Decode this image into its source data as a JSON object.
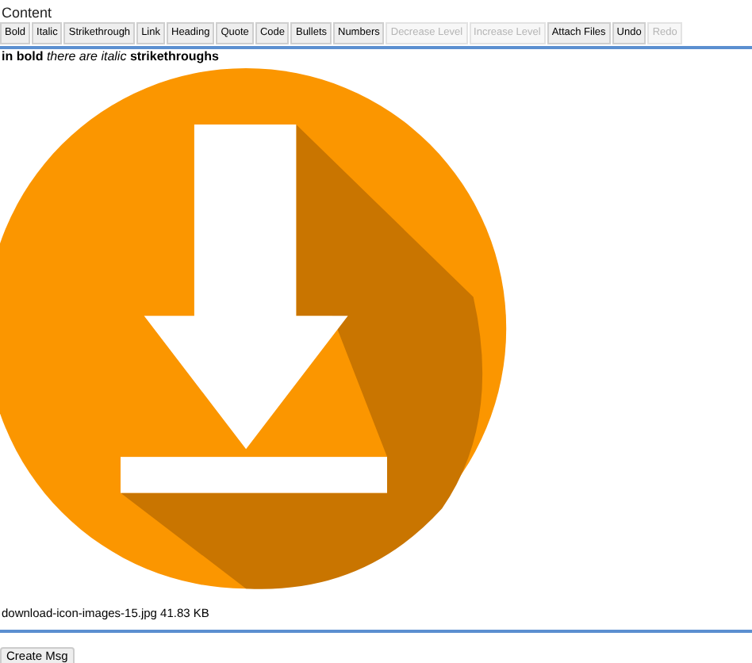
{
  "field_label": "Content",
  "toolbar": [
    {
      "label": "Bold",
      "disabled": false
    },
    {
      "label": "Italic",
      "disabled": false
    },
    {
      "label": "Strikethrough",
      "disabled": false
    },
    {
      "label": "Link",
      "disabled": false
    },
    {
      "label": "Heading",
      "disabled": false
    },
    {
      "label": "Quote",
      "disabled": false
    },
    {
      "label": "Code",
      "disabled": false
    },
    {
      "label": "Bullets",
      "disabled": false
    },
    {
      "label": "Numbers",
      "disabled": false
    },
    {
      "label": "Decrease Level",
      "disabled": true
    },
    {
      "label": "Increase Level",
      "disabled": true
    },
    {
      "label": "Attach Files",
      "disabled": false
    },
    {
      "label": "Undo",
      "disabled": false
    },
    {
      "label": "Redo",
      "disabled": true
    }
  ],
  "content_text": "**in bold** *there are italic* **strikethroughs**",
  "attachment": {
    "kind": "picture",
    "caption": "download-icon-images-15.jpg 41.83 KB"
  },
  "submit_button": "Create Msg"
}
